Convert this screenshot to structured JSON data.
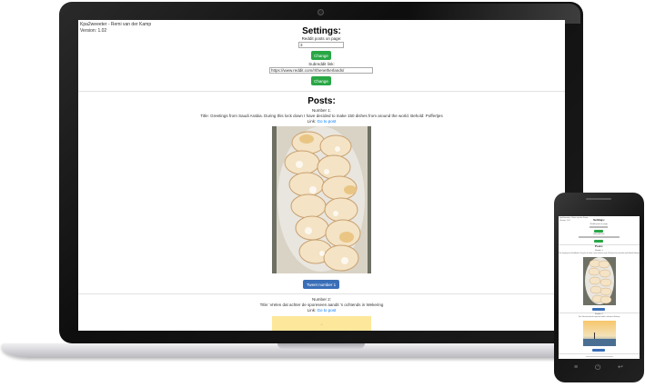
{
  "app": {
    "title": "Kpa2weeeter - Remi van der Kamp",
    "version": "Version: 1.02"
  },
  "settings": {
    "heading": "Settings:",
    "posts_per_page_label": "Reddit posts on page:",
    "posts_per_page_value": "3",
    "change_label": "Change",
    "subreddit_label": "Subreddit link:",
    "subreddit_value": "https://www.reddit.com/r/thenetherlands/"
  },
  "posts": {
    "heading": "Posts:",
    "link_prefix": "Link:",
    "link_text": "Go to post",
    "items": [
      {
        "number": "Number 1:",
        "title": "Title: Greetings from Saudi Arabia. During this lock down I have decided to make 150 dishes from around the world. Behold: Poffertjes",
        "tweet_label": "Tweet number 1"
      },
      {
        "number": "Number 2:",
        "title": "Title: Vrelen dat achter de sporeseen aandit 's ochtends in Wekering",
        "tweet_label": ""
      }
    ]
  },
  "phone": {
    "nav_icons": [
      "menu-icon",
      "home-icon",
      "back-icon"
    ]
  },
  "colors": {
    "green_button": "#28a745",
    "blue_button": "#3a6fb8",
    "link": "#007bff"
  }
}
